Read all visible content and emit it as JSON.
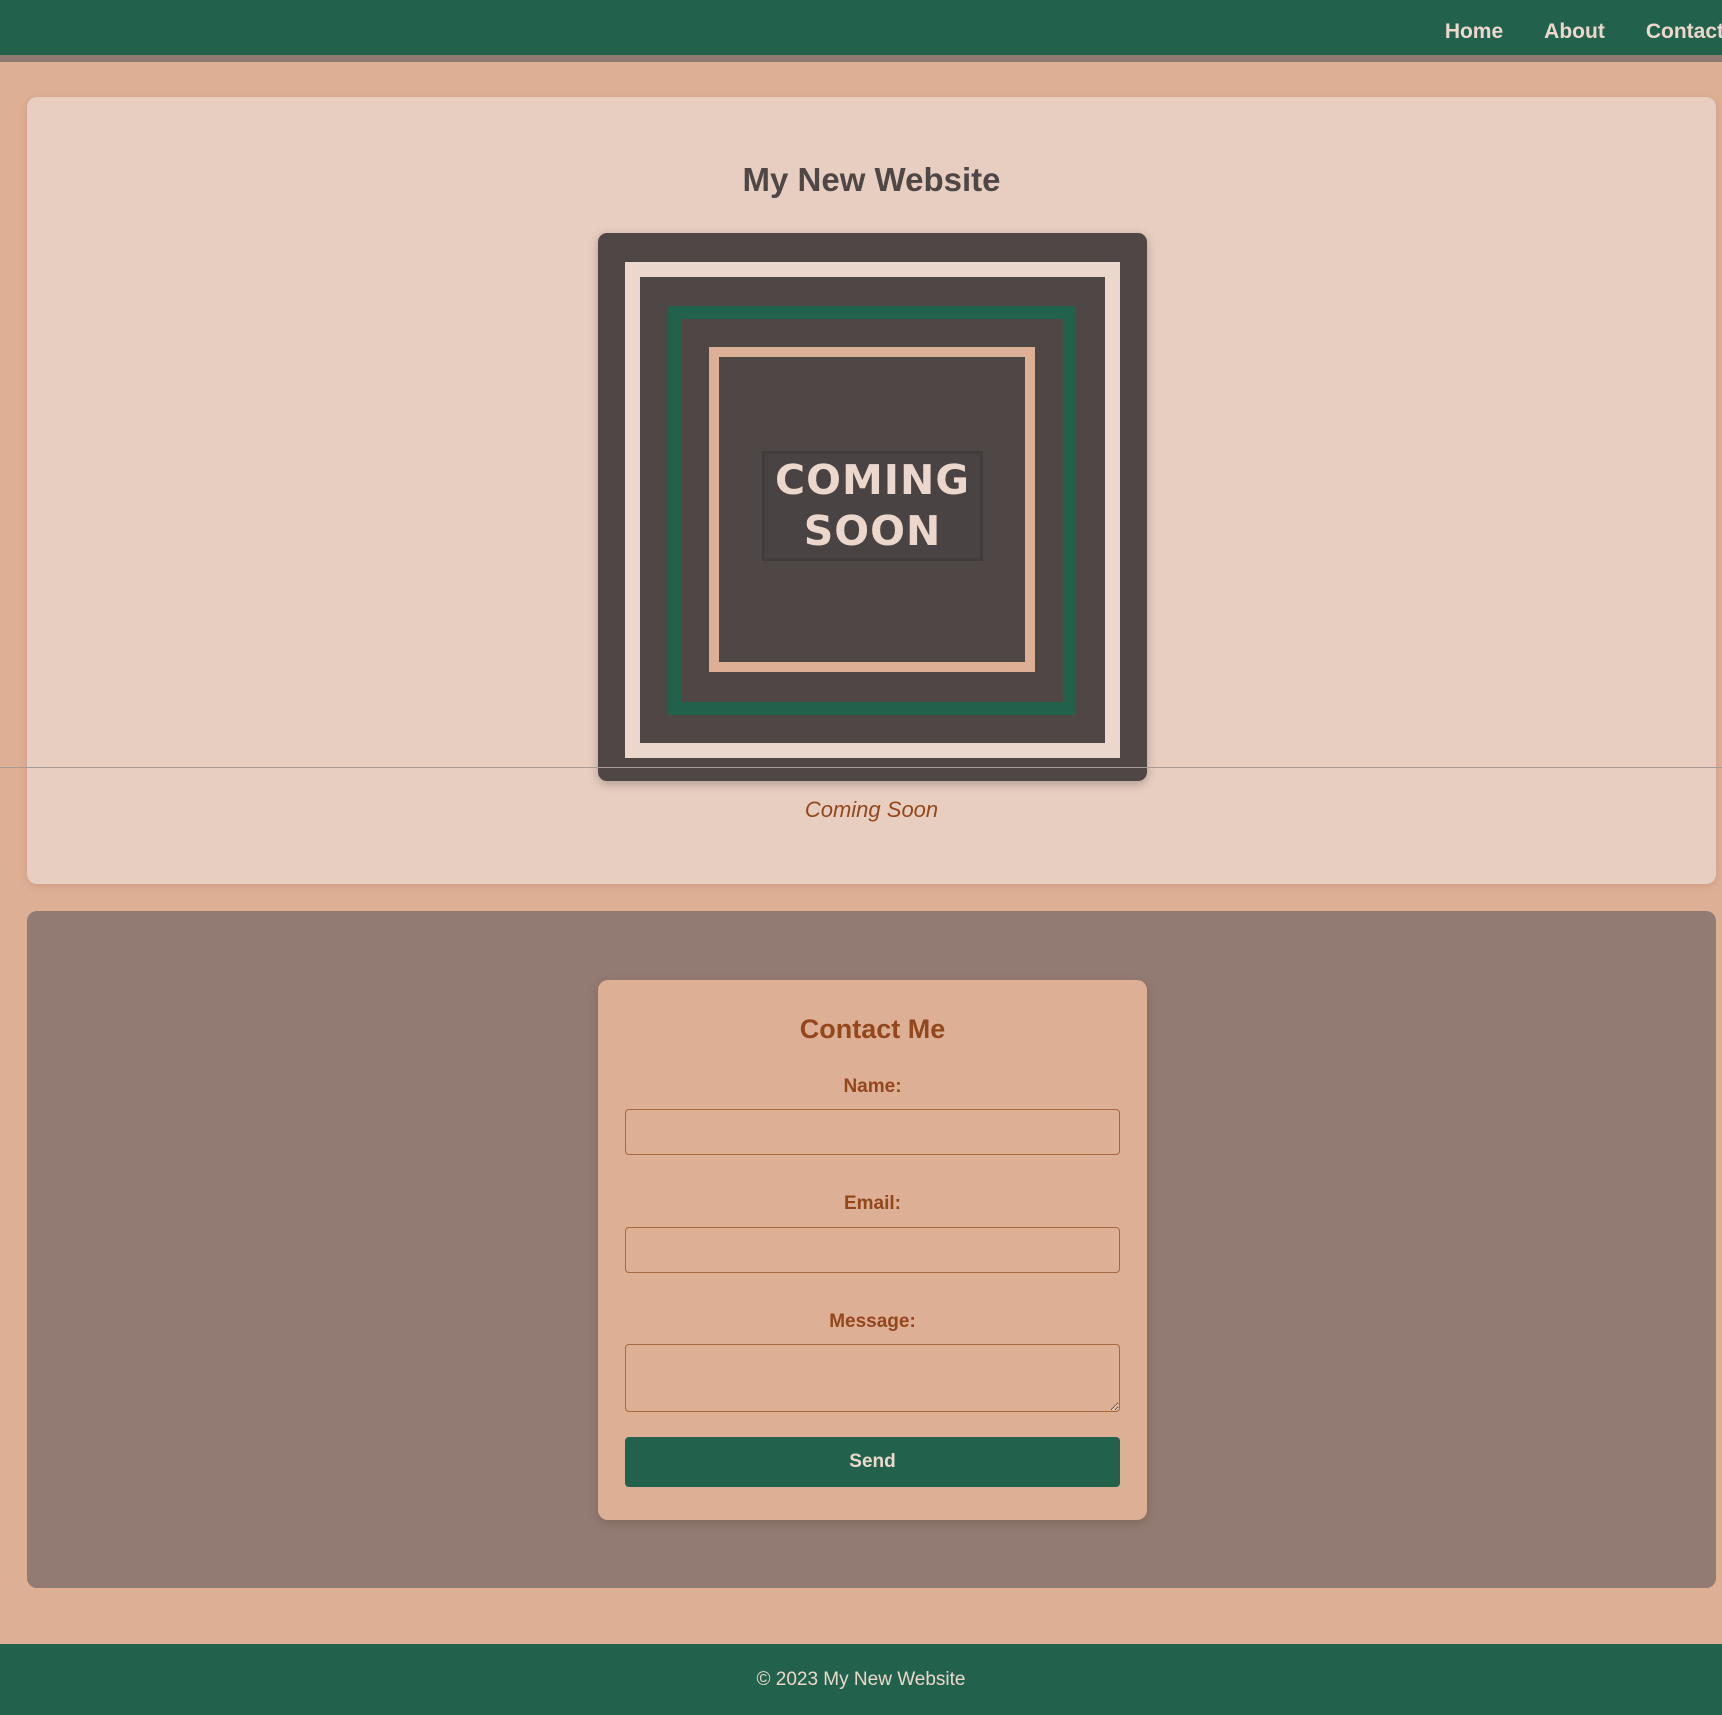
{
  "nav": {
    "links": [
      {
        "label": "Home"
      },
      {
        "label": "About"
      },
      {
        "label": "Contact"
      }
    ]
  },
  "hero": {
    "title": "My New Website",
    "poster": {
      "line1": "COMING",
      "line2": "SOON"
    },
    "caption": "Coming Soon"
  },
  "contact": {
    "title": "Contact Me",
    "name_label": "Name:",
    "name_value": "",
    "email_label": "Email:",
    "email_value": "",
    "message_label": "Message:",
    "message_value": "",
    "send_label": "Send"
  },
  "footer": {
    "text": "© 2023 My New Website"
  },
  "colors": {
    "page_background": "#ddaf95",
    "nav_background": "#22624d",
    "nav_text": "#ecd7cc",
    "hero_card": "#e8cec0",
    "poster_background": "#4f4646",
    "contact_section": "#927b72",
    "accent_text": "#93471c",
    "button": "#22624d"
  }
}
